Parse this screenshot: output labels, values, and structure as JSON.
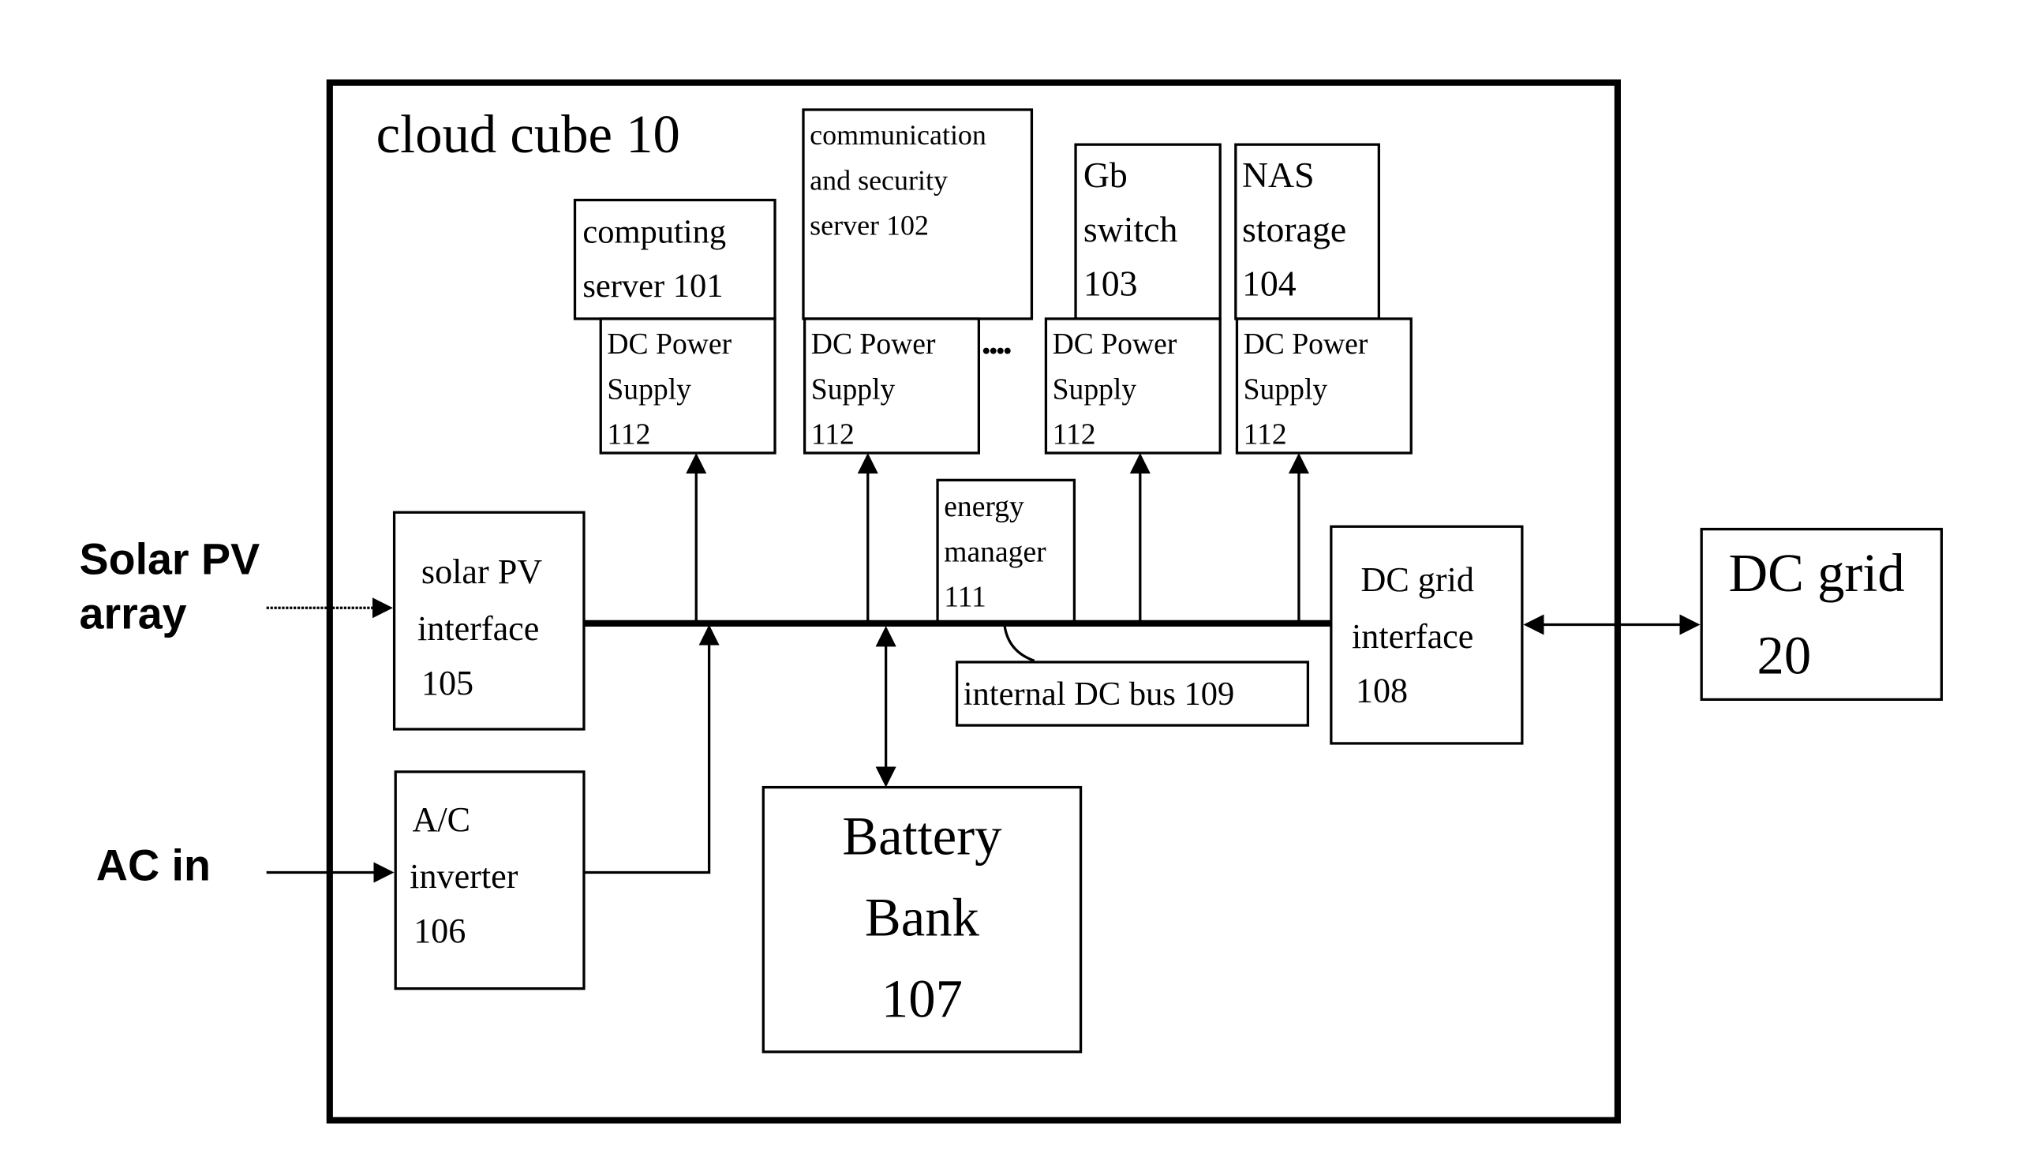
{
  "diagram": {
    "container": {
      "title": "cloud cube 10"
    },
    "external": {
      "solar": [
        "Solar PV",
        "array"
      ],
      "ac": "AC in",
      "grid": [
        "DC grid",
        "20"
      ]
    },
    "blocks": {
      "computing_server": [
        "computing",
        "server  101"
      ],
      "comm_server": [
        "communication",
        "and security",
        "server  102"
      ],
      "gb_switch": [
        "Gb",
        "switch",
        "103"
      ],
      "nas": [
        "NAS",
        "storage",
        "104"
      ],
      "psu": [
        "DC Power",
        "Supply",
        "112"
      ],
      "solar_if": [
        "solar PV",
        "interface",
        "105"
      ],
      "inverter": [
        "A/C",
        "inverter",
        "106"
      ],
      "battery": [
        "Battery",
        "Bank",
        "107"
      ],
      "energy_mgr": [
        "energy",
        "manager",
        "111"
      ],
      "bus_label": "internal DC bus  109",
      "grid_if": [
        "DC grid",
        "interface",
        "108"
      ]
    },
    "ellipsis": "....",
    "colors": {
      "ink": "#000000",
      "background": "#ffffff"
    }
  }
}
